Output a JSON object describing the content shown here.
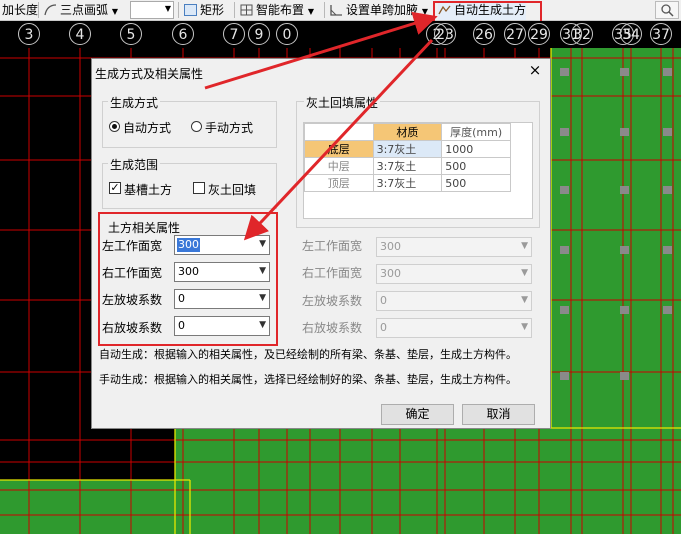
{
  "toolbar": {
    "item1": "加长度",
    "item2": "三点画弧",
    "item3": "矩形",
    "item4": "智能布置",
    "item5": "设置单跨加腋",
    "item6": "自动生成土方"
  },
  "axis": [
    "3",
    "4",
    "5",
    "6",
    "7",
    "9",
    "0",
    "",
    "",
    "",
    "",
    "",
    "",
    "",
    "2",
    "23",
    "26",
    "27",
    "29",
    "31",
    "32",
    "35",
    "34",
    "35",
    "37"
  ],
  "dialog": {
    "title": "生成方式及相关属性",
    "close": "×",
    "mode_group": "生成方式",
    "auto_mode": "自动方式",
    "manual_mode": "手动方式",
    "range_group": "生成范围",
    "range_pit": "基槽土方",
    "range_backfill": "灰土回填",
    "backfill_group": "灰土回填属性",
    "table": {
      "headers": [
        "",
        "材质",
        "厚度(mm)"
      ],
      "rows": [
        [
          "底层",
          "3:7灰土",
          "1000"
        ],
        [
          "中层",
          "3:7灰土",
          "500"
        ],
        [
          "顶层",
          "3:7灰土",
          "500"
        ]
      ]
    },
    "earth_group": "土方相关属性",
    "left_rows": [
      {
        "label": "左工作面宽",
        "value": "300"
      },
      {
        "label": "右工作面宽",
        "value": "300"
      },
      {
        "label": "左放坡系数",
        "value": "0"
      },
      {
        "label": "右放坡系数",
        "value": "0"
      }
    ],
    "right_rows": [
      {
        "label": "左工作面宽",
        "value": "300"
      },
      {
        "label": "右工作面宽",
        "value": "300"
      },
      {
        "label": "左放坡系数",
        "value": "0"
      },
      {
        "label": "右放坡系数",
        "value": "0"
      }
    ],
    "note_auto": "自动生成：根据输入的相关属性，及已经绘制的所有梁、条基、垫层，生成土方构件。",
    "note_manual": "手动生成：根据输入的相关属性，选择已经绘制好的梁、条基、垫层，生成土方构件。",
    "ok": "确定",
    "cancel": "取消"
  },
  "colors": {
    "canvas_bg": "#000000",
    "green_fill": "#2f9a2f",
    "grid_red": "#cc0000",
    "highlight_red": "#e0262a",
    "selected_cell": "#dce9f7",
    "header_cell": "#f5c676"
  }
}
